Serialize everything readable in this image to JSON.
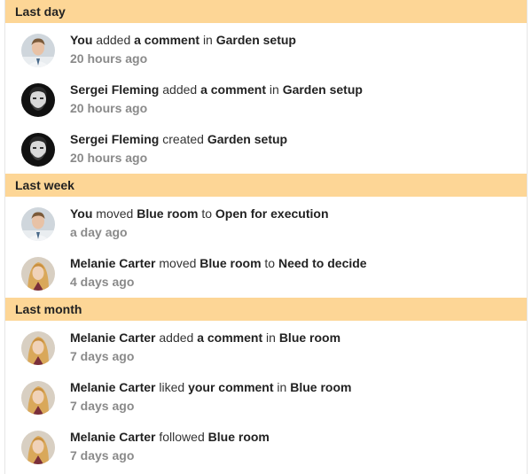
{
  "sections": [
    {
      "title": "Last day",
      "items": [
        {
          "actor": "You",
          "verb": "added",
          "object": "a comment",
          "prep": "in",
          "target": "Garden setup",
          "time": "20 hours ago",
          "avatar": "avatar-you"
        },
        {
          "actor": "Sergei Fleming",
          "verb": "added",
          "object": "a comment",
          "prep": "in",
          "target": "Garden setup",
          "time": "20 hours ago",
          "avatar": "avatar-sergei"
        },
        {
          "actor": "Sergei Fleming",
          "verb": "created",
          "object": "Garden setup",
          "prep": "",
          "target": "",
          "time": "20 hours ago",
          "avatar": "avatar-sergei"
        }
      ]
    },
    {
      "title": "Last week",
      "items": [
        {
          "actor": "You",
          "verb": "moved",
          "object": "Blue room",
          "prep": "to",
          "target": "Open for execution",
          "time": "a day ago",
          "avatar": "avatar-you"
        },
        {
          "actor": "Melanie Carter",
          "verb": "moved",
          "object": "Blue room",
          "prep": "to",
          "target": "Need to decide",
          "time": "4 days ago",
          "avatar": "avatar-melanie"
        }
      ]
    },
    {
      "title": "Last month",
      "items": [
        {
          "actor": "Melanie Carter",
          "verb": "added",
          "object": "a comment",
          "prep": "in",
          "target": "Blue room",
          "time": "7 days ago",
          "avatar": "avatar-melanie"
        },
        {
          "actor": "Melanie Carter",
          "verb": "liked",
          "object": "your comment",
          "prep": "in",
          "target": "Blue room",
          "time": "7 days ago",
          "avatar": "avatar-melanie"
        },
        {
          "actor": "Melanie Carter",
          "verb": "followed",
          "object": "Blue room",
          "prep": "",
          "target": "",
          "time": "7 days ago",
          "avatar": "avatar-melanie"
        }
      ]
    }
  ],
  "colors": {
    "header_bg": "#fdd696",
    "time_text": "#8a8a8a"
  }
}
